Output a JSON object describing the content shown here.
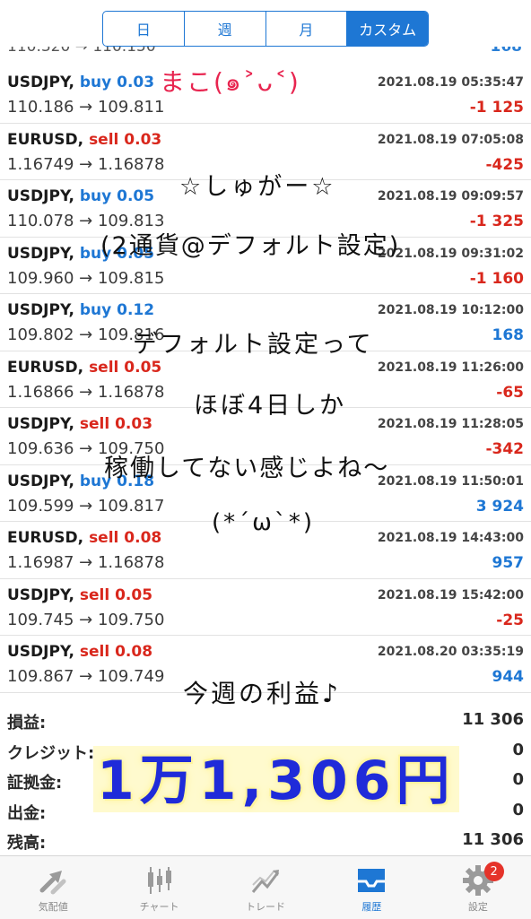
{
  "segments": [
    "日",
    "週",
    "月",
    "カスタム"
  ],
  "partial_top": {
    "text": "110.320 → 110.150",
    "profit": "168"
  },
  "deals": [
    {
      "symbol": "USDJPY",
      "side": "buy",
      "lot": "0.03",
      "time": "2021.08.19 05:35:47",
      "prices": "110.186 → 109.811",
      "profit": "-1 125",
      "sign": "neg"
    },
    {
      "symbol": "EURUSD",
      "side": "sell",
      "lot": "0.03",
      "time": "2021.08.19 07:05:08",
      "prices": "1.16749 → 1.16878",
      "profit": "-425",
      "sign": "neg"
    },
    {
      "symbol": "USDJPY",
      "side": "buy",
      "lot": "0.05",
      "time": "2021.08.19 09:09:57",
      "prices": "110.078 → 109.813",
      "profit": "-1 325",
      "sign": "neg"
    },
    {
      "symbol": "USDJPY",
      "side": "buy",
      "lot": "0.05",
      "time": "2021.08.19 09:31:02",
      "prices": "109.960 → 109.815",
      "profit": "-1 160",
      "sign": "neg"
    },
    {
      "symbol": "USDJPY",
      "side": "buy",
      "lot": "0.12",
      "time": "2021.08.19 10:12:00",
      "prices": "109.802 → 109.816",
      "profit": "168",
      "sign": "pos"
    },
    {
      "symbol": "EURUSD",
      "side": "sell",
      "lot": "0.05",
      "time": "2021.08.19 11:26:00",
      "prices": "1.16866 → 1.16878",
      "profit": "-65",
      "sign": "neg"
    },
    {
      "symbol": "USDJPY",
      "side": "sell",
      "lot": "0.03",
      "time": "2021.08.19 11:28:05",
      "prices": "109.636 → 109.750",
      "profit": "-342",
      "sign": "neg"
    },
    {
      "symbol": "USDJPY",
      "side": "buy",
      "lot": "0.18",
      "time": "2021.08.19 11:50:01",
      "prices": "109.599 → 109.817",
      "profit": "3 924",
      "sign": "pos"
    },
    {
      "symbol": "EURUSD",
      "side": "sell",
      "lot": "0.08",
      "time": "2021.08.19 14:43:00",
      "prices": "1.16987 → 1.16878",
      "profit": "957",
      "sign": "pos"
    },
    {
      "symbol": "USDJPY",
      "side": "sell",
      "lot": "0.05",
      "time": "2021.08.19 15:42:00",
      "prices": "109.745 → 109.750",
      "profit": "-25",
      "sign": "neg"
    },
    {
      "symbol": "USDJPY",
      "side": "sell",
      "lot": "0.08",
      "time": "2021.08.20 03:35:19",
      "prices": "109.867 → 109.749",
      "profit": "944",
      "sign": "pos"
    }
  ],
  "summary": [
    {
      "label": "損益:",
      "value": "11 306"
    },
    {
      "label": "クレジット:",
      "value": "0"
    },
    {
      "label": "証拠金:",
      "value": "0"
    },
    {
      "label": "出金:",
      "value": "0"
    },
    {
      "label": "残高:",
      "value": "11 306"
    }
  ],
  "handwriting": {
    "name": "まこ(๑˃ᴗ˂)",
    "line1": "☆しゅがー☆",
    "line2": "(2通貨@デフォルト設定)",
    "line3": "デフォルト設定って",
    "line4": "ほぼ4日しか",
    "line5": "稼働してない感じよね〜",
    "line6": "(*ˊωˋ*)",
    "line7": "今週の利益♪",
    "big": "1万1,306円"
  },
  "tabs": [
    {
      "label": "気配値",
      "icon": "quotes-icon"
    },
    {
      "label": "チャート",
      "icon": "chart-candles-icon"
    },
    {
      "label": "トレード",
      "icon": "trade-icon"
    },
    {
      "label": "履歴",
      "icon": "history-inbox-icon",
      "active": true
    },
    {
      "label": "設定",
      "icon": "gear-icon",
      "badge": "2"
    }
  ],
  "colors": {
    "accent": "#1e77d4",
    "negative": "#d9271c",
    "handwriting_big": "#1f2bd9",
    "name": "#e8244f"
  }
}
